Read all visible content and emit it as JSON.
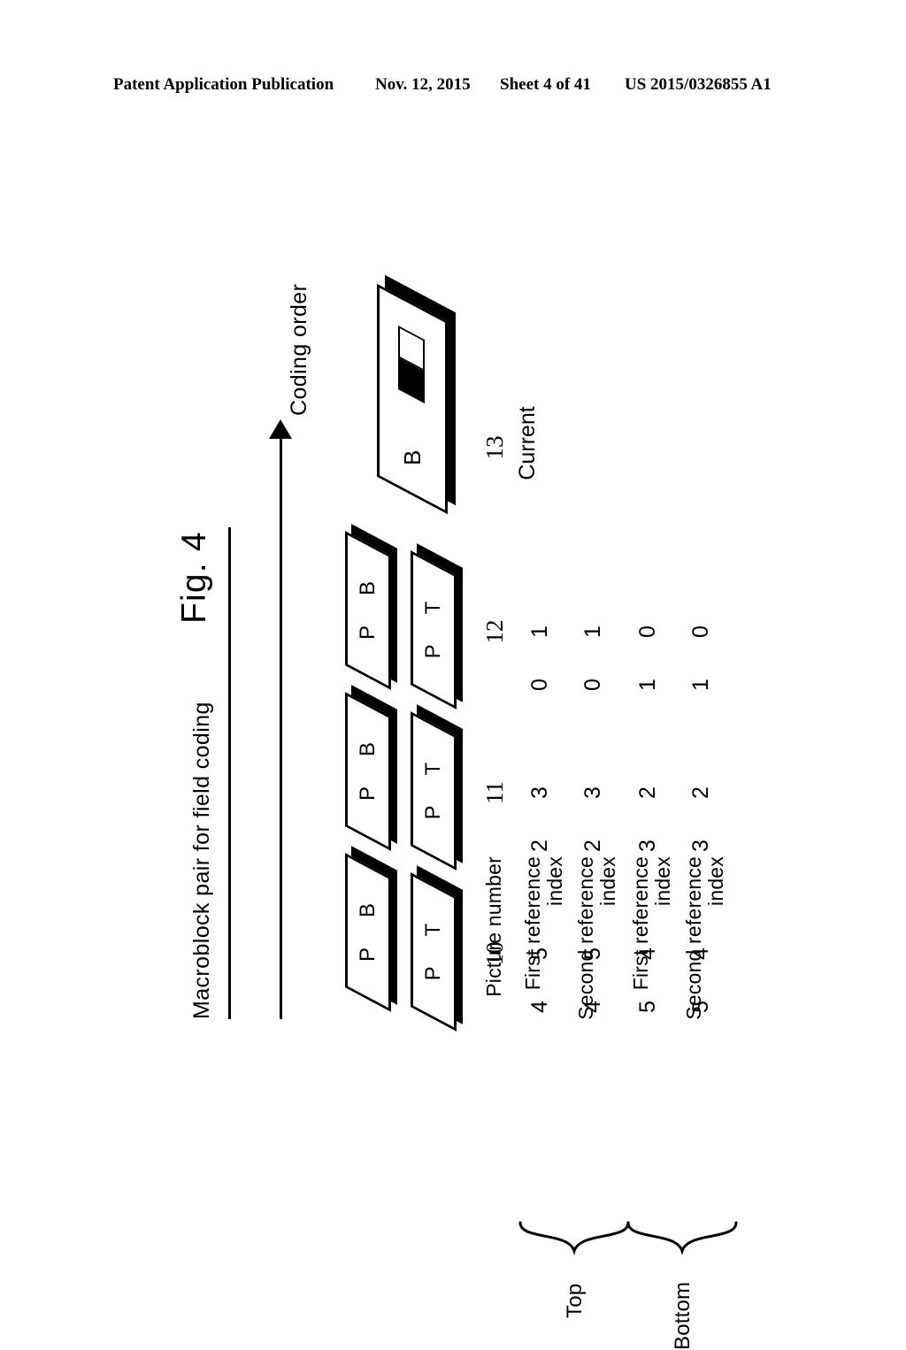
{
  "header": {
    "publication": "Patent Application Publication",
    "date": "Nov. 12, 2015",
    "sheet": "Sheet 4 of 41",
    "number": "US 2015/0326855 A1"
  },
  "figure": {
    "number_label": "Fig. 4",
    "subtitle": "Macroblock pair for field coding",
    "axis_label": "Coding order",
    "axis_arrow_icon": "right-arrow-icon"
  },
  "pictures": [
    {
      "number": "10",
      "top_field": {
        "type": "P",
        "field": "T"
      },
      "bottom_field": {
        "type": "P",
        "field": "B"
      }
    },
    {
      "number": "11",
      "top_field": {
        "type": "P",
        "field": "T"
      },
      "bottom_field": {
        "type": "P",
        "field": "B"
      }
    },
    {
      "number": "12",
      "top_field": {
        "type": "P",
        "field": "T"
      },
      "bottom_field": {
        "type": "P",
        "field": "B"
      }
    }
  ],
  "current_picture": {
    "number": "13",
    "caption": "Current",
    "type": "B",
    "macroblock_pair_icon": "black-white-macroblock-pair-icon"
  },
  "table": {
    "picture_number_label": "Picture number",
    "groups": [
      {
        "tag": "Top",
        "rows": [
          {
            "label": "First reference\nindex"
          },
          {
            "label": "Second reference\nindex"
          }
        ]
      },
      {
        "tag": "Bottom",
        "rows": [
          {
            "label": "First reference\nindex"
          },
          {
            "label": "Second reference\nindex"
          }
        ]
      }
    ],
    "column_numbers": [
      "10",
      "11",
      "12"
    ],
    "values": {
      "top_first_index": {
        "10_T": "4",
        "10_B": "5",
        "11_T": "2",
        "11_B": "3",
        "12_T": "0",
        "12_B": "1"
      },
      "top_second_index": {
        "10_T": "4",
        "10_B": "5",
        "11_T": "2",
        "11_B": "3",
        "12_T": "0",
        "12_B": "1"
      },
      "bottom_first_index": {
        "10_T": "5",
        "10_B": "4",
        "11_T": "3",
        "11_B": "2",
        "12_T": "1",
        "12_B": "0"
      },
      "bottom_second_index": {
        "10_T": "5",
        "10_B": "4",
        "11_T": "3",
        "11_B": "2",
        "12_T": "1",
        "12_B": "0"
      }
    }
  },
  "colors": {
    "ink": "#000000",
    "paper": "#ffffff"
  }
}
